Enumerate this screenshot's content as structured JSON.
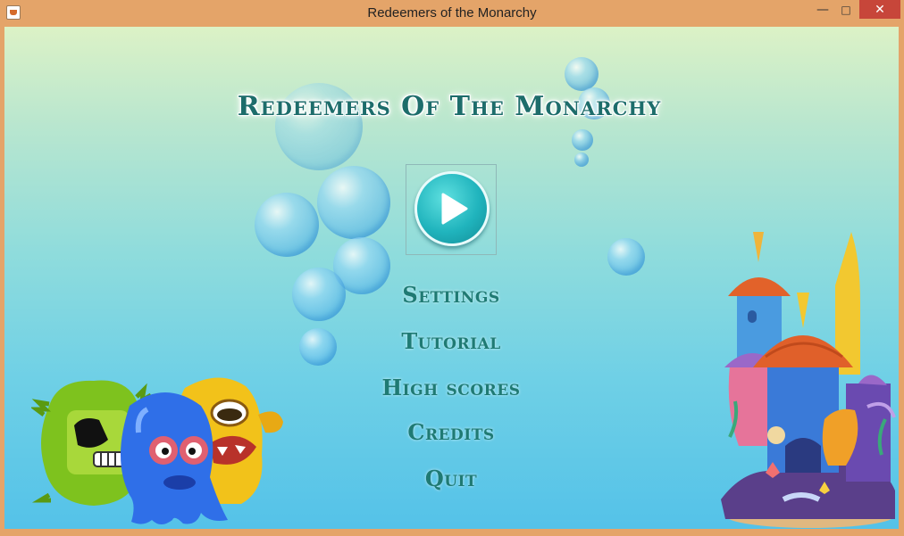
{
  "window": {
    "title": "Redeemers of the Monarchy",
    "min_icon": "minimize-icon",
    "max_icon": "maximize-icon",
    "close_icon": "close-icon"
  },
  "game": {
    "logo": "Redeemers Of The Monarchy"
  },
  "menu": [
    {
      "id": "settings",
      "label": "Settings"
    },
    {
      "id": "tutorial",
      "label": "Tutorial"
    },
    {
      "id": "high-scores",
      "label": "High scores"
    },
    {
      "id": "credits",
      "label": "Credits"
    },
    {
      "id": "quit",
      "label": "Quit"
    }
  ],
  "icons": {
    "play": "play-icon",
    "app": "java-app-icon"
  },
  "colors": {
    "title_bar": "#e4a469",
    "close": "#c7463a",
    "menu_text": "#1f7a73",
    "logo_text": "#1d6d6b",
    "play_button": "#20b4bd"
  }
}
